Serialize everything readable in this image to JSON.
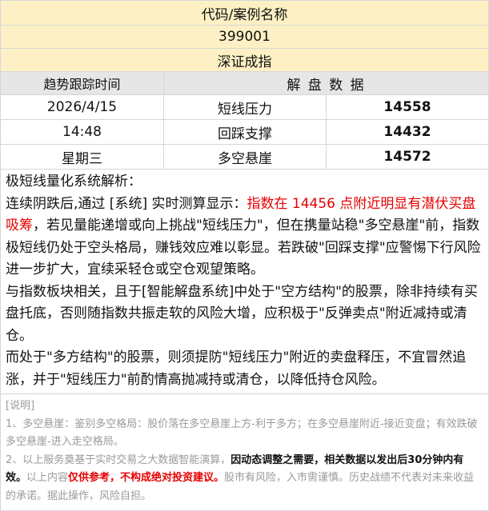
{
  "header": {
    "title": "代码/案例名称",
    "code": "399001",
    "name": "深证成指"
  },
  "table": {
    "col_time": "趋势跟踪时间",
    "col_data": "解 盘 数 据",
    "rows": [
      {
        "time": "2026/4/15",
        "label": "短线压力",
        "value": "14558"
      },
      {
        "time": "14:48",
        "label": "回踩支撑",
        "value": "14432"
      },
      {
        "time": "星期三",
        "label": "多空悬崖",
        "value": "14572"
      }
    ]
  },
  "analysis": {
    "title": "极短线量化系统解析：",
    "p1_a": "连续阴跌后,通过 [系统] 实时测算显示：",
    "p1_red": "指数在 14456 点附近明显有潜伏买盘吸筹",
    "p1_b": "，若见量能递增或向上挑战\"短线压力\"，但在携量站稳\"多空悬崖\"前，指数极短线仍处于空头格局，赚钱效应难以彰显。若跌破\"回踩支撑\"应警惕下行风险进一步扩大，宜续采轻仓或空仓观望策略。",
    "p2": "与指数板块相关，且于[智能解盘系统]中处于\"空方结构\"的股票，除非持续有买盘托底，否则随指数共振走软的风险大增，应积极于\"反弹卖点\"附近减持或清仓。",
    "p3": "而处于\"多方结构\"的股票，则须提防\"短线压力\"附近的卖盘释压，不宜冒然追涨，并于\"短线压力\"前酌情高抛减持或清仓，以降低持仓风险。"
  },
  "notes": {
    "title": "[说明]",
    "n1": "1、多空悬崖：鉴别多空格局：股价落在多空悬崖上方-利于多方；在多空悬崖附近-接近变盘；有效跌破多空悬崖-进入走空格局。",
    "n2_a": "2、以上服务奠基于实时交易之大数据智能演算，",
    "n2_bold": "因动态调整之需要，相关数据以发出后30分钟内有效。",
    "n2_b": "以上内容",
    "n2_red": "仅供参考，不构成绝对投资建议。",
    "n2_c": "股市有风险，入市需谨慎。历史战绩不代表对未来收益的承诺。据此操作，风险自担。"
  }
}
